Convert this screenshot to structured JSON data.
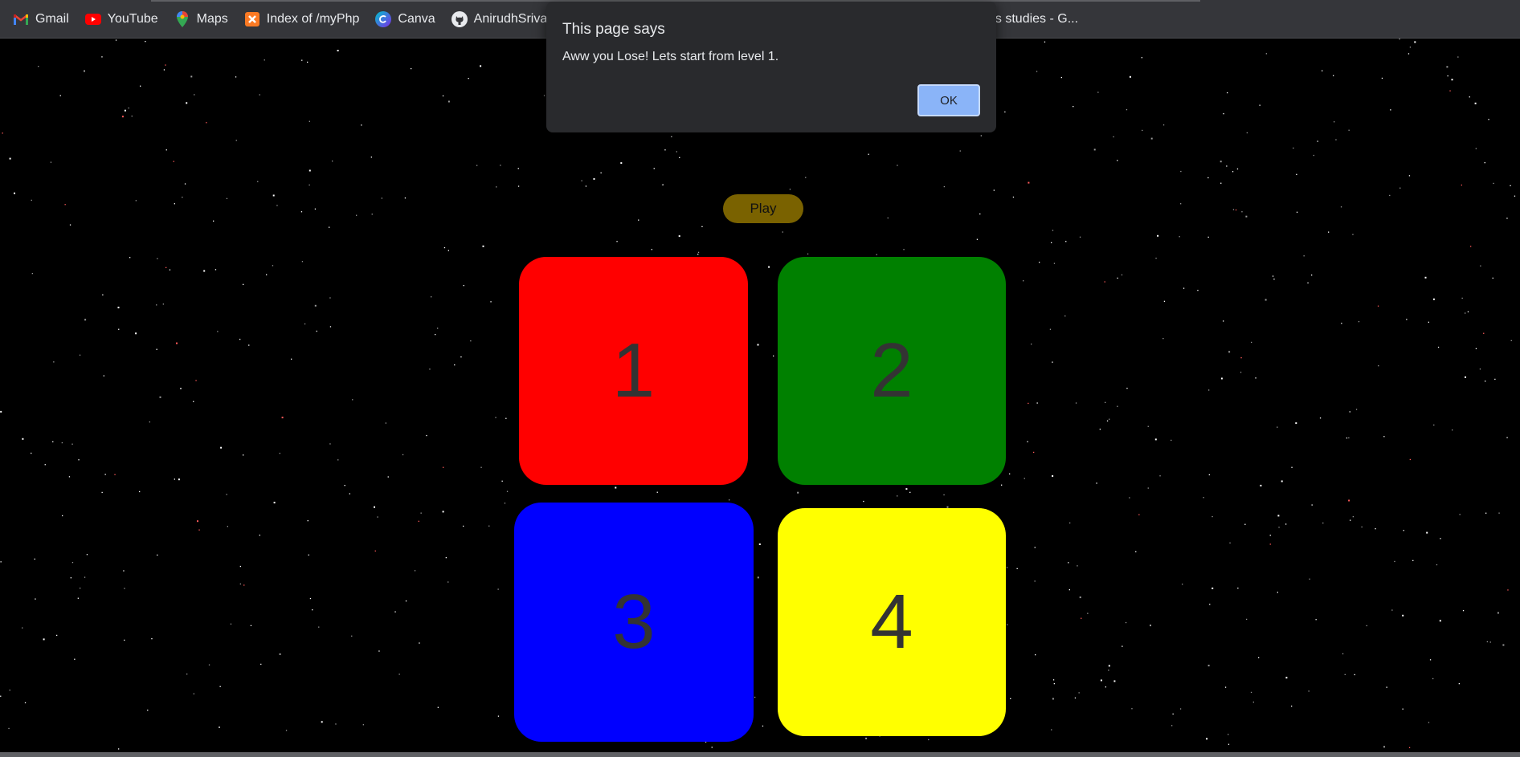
{
  "bookmarks": [
    {
      "label": "Gmail",
      "icon": "gmail-icon"
    },
    {
      "label": "YouTube",
      "icon": "youtube-icon"
    },
    {
      "label": "Maps",
      "icon": "maps-icon"
    },
    {
      "label": "Index of /myPhp",
      "icon": "xampp-icon"
    },
    {
      "label": "Canva",
      "icon": "canva-icon"
    },
    {
      "label": "AnirudhSrivast",
      "icon": "github-icon"
    }
  ],
  "bookmark_overflow_label": "ess studies - G...",
  "game": {
    "play_label": "Play",
    "tiles": [
      {
        "number": "1",
        "color": "#ff0000"
      },
      {
        "number": "2",
        "color": "#008000"
      },
      {
        "number": "3",
        "color": "#0000ff"
      },
      {
        "number": "4",
        "color": "#ffff00"
      }
    ]
  },
  "dialog": {
    "title": "This page says",
    "message": "Aww you Lose! Lets start from level 1.",
    "ok_label": "OK"
  },
  "colors": {
    "background": "#000000",
    "play_button": "#7a6200",
    "tile_text": "#333333",
    "dialog_bg": "#292a2d",
    "dialog_button": "#8ab4f8"
  }
}
